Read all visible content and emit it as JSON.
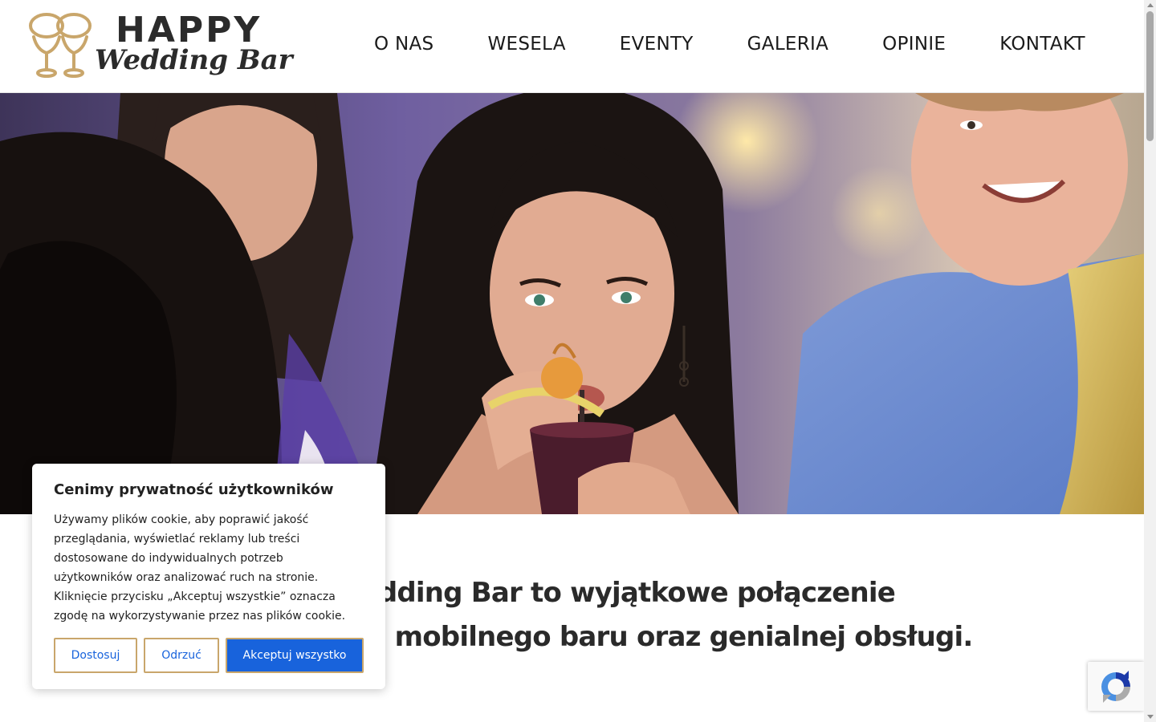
{
  "brand": {
    "line1": "HAPPY",
    "line2": "Wedding Bar",
    "gold": "#c9a66b",
    "dark": "#2b2b2b"
  },
  "nav": {
    "items": [
      "O NAS",
      "WESELA",
      "EVENTY",
      "GALERIA",
      "OPINIE",
      "KONTAKT"
    ]
  },
  "hero": {
    "image": "photo of guests at a wedding party, woman in center sipping a cocktail through a straw"
  },
  "intro": {
    "line1": "Vedding Bar to wyjątkowe połączenie",
    "line2": "go mobilnego baru oraz genialnej obsługi."
  },
  "cookie": {
    "title": "Cenimy prywatność użytkowników",
    "text": "Używamy plików cookie, aby poprawić jakość przeglądania, wyświetlać reklamy lub treści dostosowane do indywidualnych potrzeb użytkowników oraz analizować ruch na stronie. Kliknięcie przycisku „Akceptuj wszystkie” oznacza zgodę na wykorzystywanie przez nas plików cookie.",
    "customize_label": "Dostosuj",
    "reject_label": "Odrzuć",
    "accept_label": "Akceptuj wszystko",
    "accent": "#1863dc",
    "border": "#c9a66b"
  },
  "icons": {
    "logo": "two-wine-glasses-rings-icon",
    "recaptcha": "recaptcha-icon"
  }
}
